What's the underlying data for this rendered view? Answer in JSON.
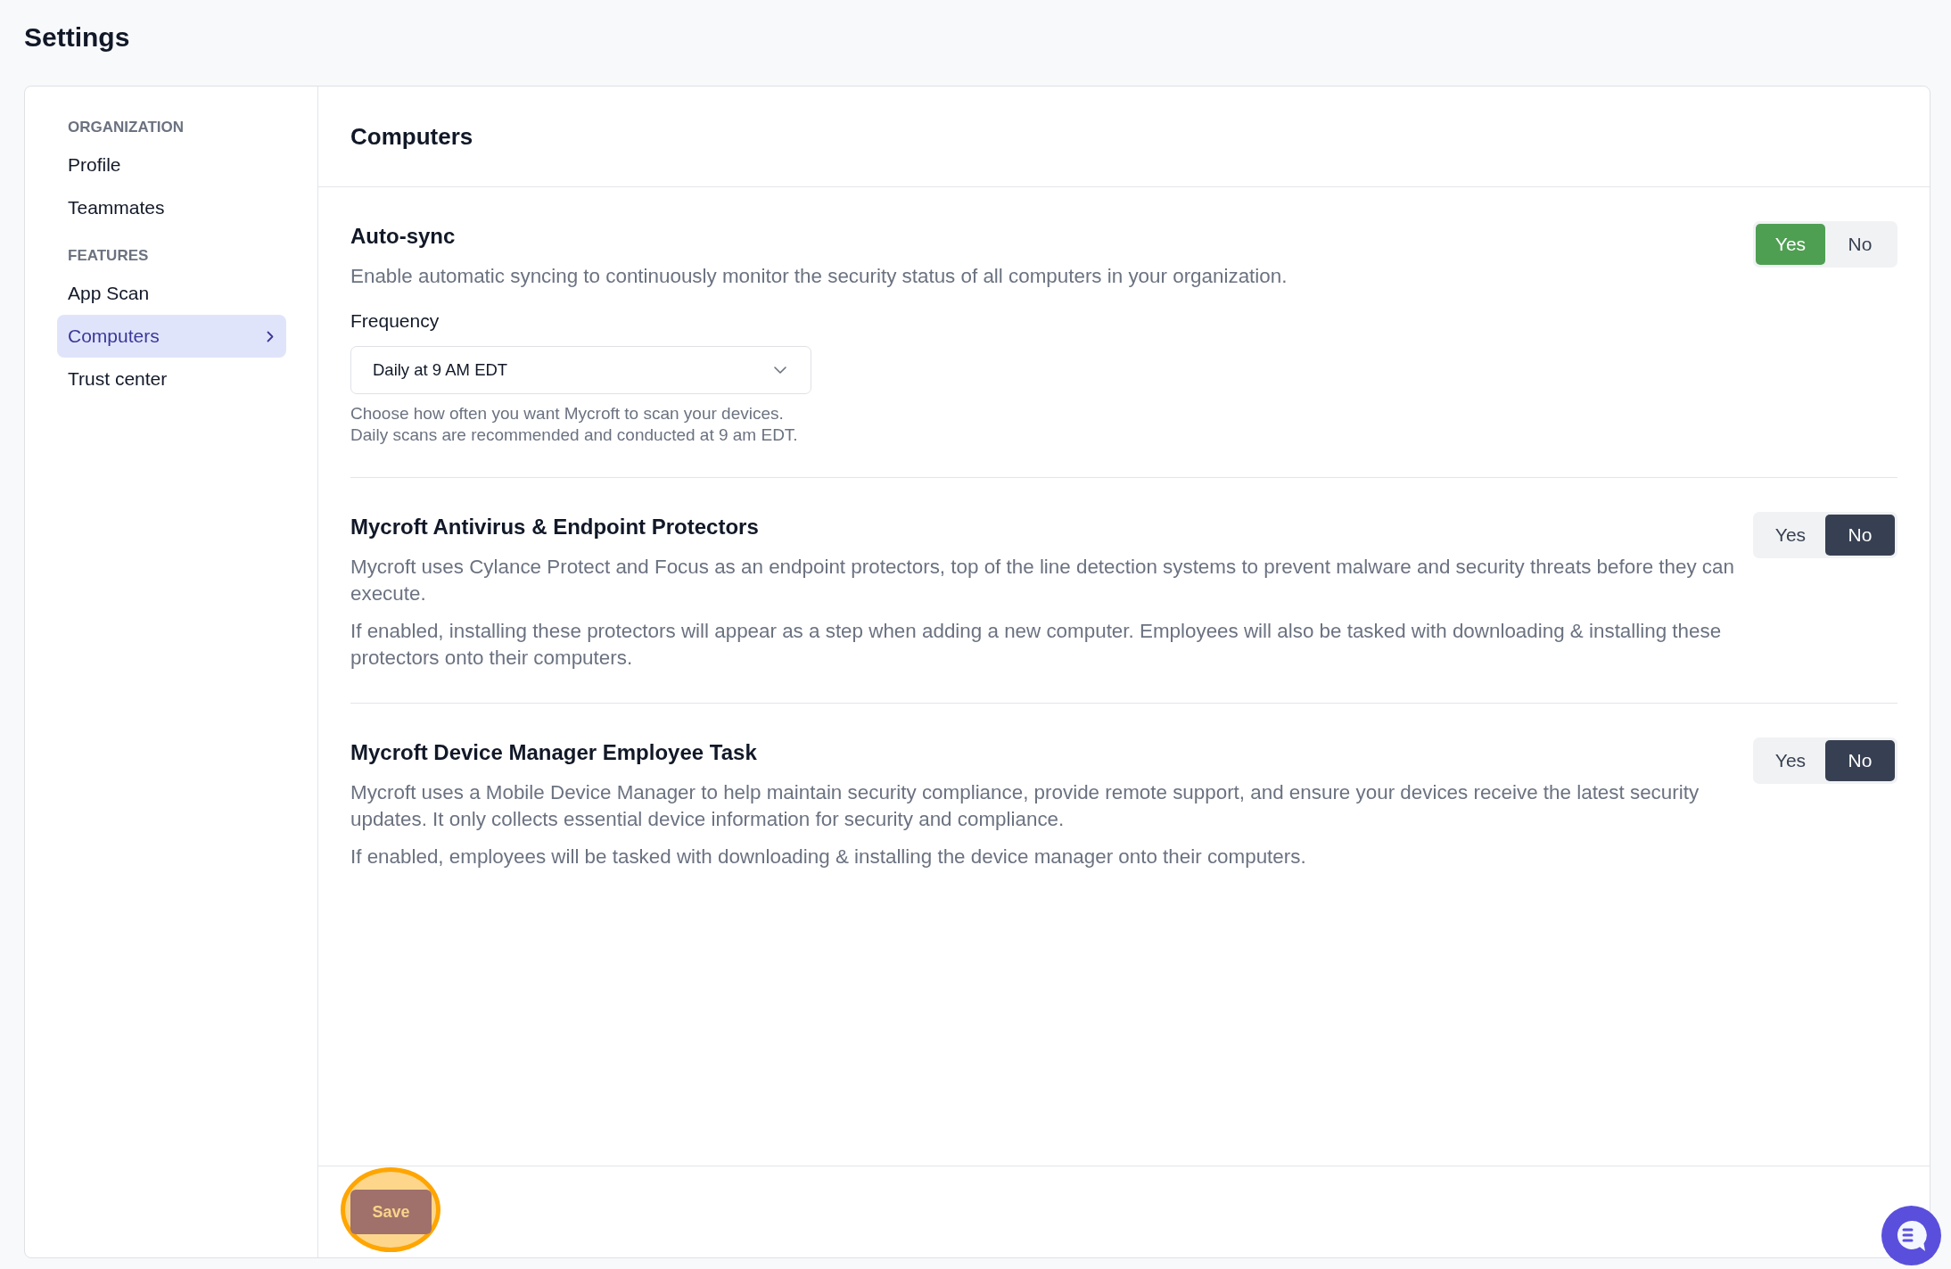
{
  "page": {
    "title": "Settings"
  },
  "sidebar": {
    "groups": [
      {
        "heading": "ORGANIZATION",
        "items": [
          {
            "label": "Profile",
            "selected": false
          },
          {
            "label": "Teammates",
            "selected": false
          }
        ]
      },
      {
        "heading": "FEATURES",
        "items": [
          {
            "label": "App Scan",
            "selected": false
          },
          {
            "label": "Computers",
            "selected": true
          },
          {
            "label": "Trust center",
            "selected": false
          }
        ]
      }
    ]
  },
  "main": {
    "title": "Computers",
    "sections": [
      {
        "title": "Auto-sync",
        "paragraphs": [
          "Enable automatic syncing to continuously monitor the security status of all computers in your organization."
        ],
        "frequency": {
          "label": "Frequency",
          "value": "Daily at 9 AM EDT",
          "help": "Choose how often you want Mycroft to scan your devices. Daily scans are recommended and conducted at 9 am EDT."
        },
        "toggle": {
          "options": [
            {
              "label": "Yes",
              "selected": true
            },
            {
              "label": "No",
              "selected": false
            }
          ]
        }
      },
      {
        "title": "Mycroft Antivirus & Endpoint Protectors",
        "paragraphs": [
          "Mycroft uses Cylance Protect and Focus as an endpoint protectors, top of the line detection systems to prevent malware and security threats before they can execute.",
          "If enabled, installing these protectors will appear as a step when adding a new computer. Employees will also be tasked with downloading & installing these protectors onto their computers."
        ],
        "toggle": {
          "options": [
            {
              "label": "Yes",
              "selected": false
            },
            {
              "label": "No",
              "selected": true
            }
          ]
        }
      },
      {
        "title": "Mycroft Device Manager Employee Task",
        "paragraphs": [
          "Mycroft uses a Mobile Device Manager to help maintain security compliance, provide remote support, and ensure your devices receive the latest security updates. It only collects essential device information for security and compliance.",
          "If enabled, employees will be tasked with downloading & installing the device manager onto their computers."
        ],
        "toggle": {
          "options": [
            {
              "label": "Yes",
              "selected": false
            },
            {
              "label": "No",
              "selected": true
            }
          ]
        }
      }
    ]
  },
  "footer": {
    "save_button": "Save"
  }
}
